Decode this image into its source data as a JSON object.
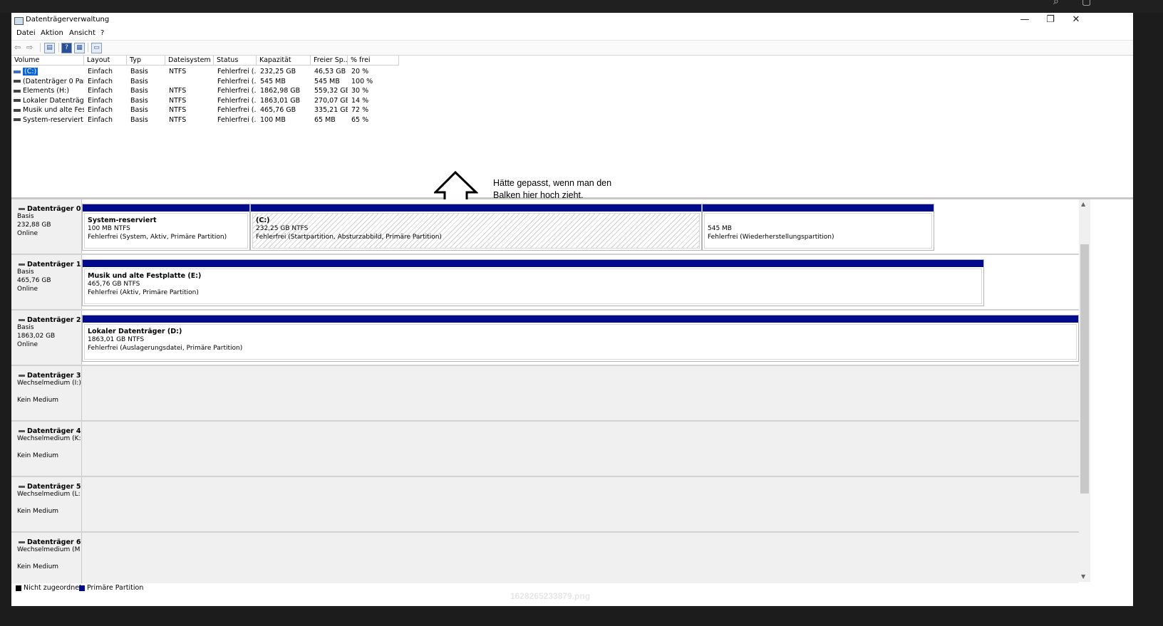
{
  "window": {
    "title": "Datenträgerverwaltung",
    "controls": {
      "minimize": "—",
      "restore": "❐",
      "close": "✕"
    }
  },
  "menu": [
    "Datei",
    "Aktion",
    "Ansicht",
    "?"
  ],
  "toolbar": {
    "back_icon": "⇦",
    "forward_icon": "⇨",
    "props_icon": "▤",
    "help_icon": "?",
    "console_icon": "▦",
    "list_icon": "▭"
  },
  "volume_list": {
    "columns": [
      "Volume",
      "Layout",
      "Typ",
      "Dateisystem",
      "Status",
      "Kapazität",
      "Freier Sp...",
      "% frei"
    ],
    "rows": [
      {
        "volume": "(C:)",
        "layout": "Einfach",
        "typ": "Basis",
        "fs": "NTFS",
        "status": "Fehlerfrei (...",
        "kapazitaet": "232,25 GB",
        "frei": "46,53 GB",
        "prozent": "20 %"
      },
      {
        "volume": "(Datenträger 0 Par...",
        "layout": "Einfach",
        "typ": "Basis",
        "fs": "",
        "status": "Fehlerfrei (...",
        "kapazitaet": "545 MB",
        "frei": "545 MB",
        "prozent": "100 %"
      },
      {
        "volume": "Elements (H:)",
        "layout": "Einfach",
        "typ": "Basis",
        "fs": "NTFS",
        "status": "Fehlerfrei (...",
        "kapazitaet": "1862,98 GB",
        "frei": "559,32 GB",
        "prozent": "30 %"
      },
      {
        "volume": "Lokaler Datenträg...",
        "layout": "Einfach",
        "typ": "Basis",
        "fs": "NTFS",
        "status": "Fehlerfrei (...",
        "kapazitaet": "1863,01 GB",
        "frei": "270,07 GB",
        "prozent": "14 %"
      },
      {
        "volume": "Musik und alte Fes...",
        "layout": "Einfach",
        "typ": "Basis",
        "fs": "NTFS",
        "status": "Fehlerfrei (...",
        "kapazitaet": "465,76 GB",
        "frei": "335,21 GB",
        "prozent": "72 %"
      },
      {
        "volume": "System-reserviert",
        "layout": "Einfach",
        "typ": "Basis",
        "fs": "NTFS",
        "status": "Fehlerfrei (...",
        "kapazitaet": "100 MB",
        "frei": "65 MB",
        "prozent": "65 %"
      }
    ]
  },
  "annotation": {
    "line1": "Hätte gepasst, wenn man den",
    "line2": "Balken hier hoch zieht."
  },
  "disks": [
    {
      "name": "Datenträger 0",
      "type": "Basis",
      "size": "232,88 GB",
      "state": "Online",
      "partitions": [
        {
          "title": "System-reserviert",
          "size": "100 MB NTFS",
          "status": "Fehlerfrei (System, Aktiv, Primäre Partition)"
        },
        {
          "title": "(C:)",
          "size": "232,25 GB NTFS",
          "status": "Fehlerfrei (Startpartition, Absturzabbild, Primäre Partition)"
        },
        {
          "title": "",
          "size": "545 MB",
          "status": "Fehlerfrei (Wiederherstellungspartition)"
        }
      ]
    },
    {
      "name": "Datenträger 1",
      "type": "Basis",
      "size": "465,76 GB",
      "state": "Online",
      "partitions": [
        {
          "title": "Musik und alte Festplatte  (E:)",
          "size": "465,76 GB NTFS",
          "status": "Fehlerfrei (Aktiv, Primäre Partition)"
        }
      ]
    },
    {
      "name": "Datenträger 2",
      "type": "Basis",
      "size": "1863,02 GB",
      "state": "Online",
      "partitions": [
        {
          "title": "Lokaler Datenträger  (D:)",
          "size": "1863,01 GB NTFS",
          "status": "Fehlerfrei (Auslagerungsdatei, Primäre Partition)"
        }
      ]
    },
    {
      "name": "Datenträger 3",
      "type": "Wechselmedium (I:)",
      "state": "Kein Medium"
    },
    {
      "name": "Datenträger 4",
      "type": "Wechselmedium (K:",
      "state": "Kein Medium"
    },
    {
      "name": "Datenträger 5",
      "type": "Wechselmedium (L:",
      "state": "Kein Medium"
    },
    {
      "name": "Datenträger 6",
      "type": "Wechselmedium (M",
      "state": "Kein Medium"
    }
  ],
  "legend": {
    "unallocated": "Nicht zugeordnet",
    "primary": "Primäre Partition",
    "colors": {
      "unallocated": "#000000",
      "primary": "#000a8c"
    }
  },
  "filename": "1628265233879.png"
}
